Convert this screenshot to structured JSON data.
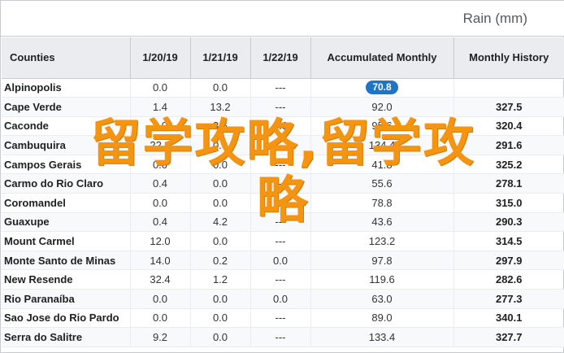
{
  "title": "Rain (mm)",
  "columns": [
    "Counties",
    "1/20/19",
    "1/21/19",
    "1/22/19",
    "Accumulated Monthly",
    "Monthly History"
  ],
  "rows": [
    {
      "name": "Alpinopolis",
      "d1": "0.0",
      "d2": "0.0",
      "d3": "---",
      "acc": "70.8",
      "hist": ""
    },
    {
      "name": "Cape Verde",
      "d1": "1.4",
      "d2": "13.2",
      "d3": "---",
      "acc": "92.0",
      "hist": "327.5"
    },
    {
      "name": "Caconde",
      "d1": "0.0",
      "d2": "3.6",
      "d3": "0.0",
      "acc": "95.6",
      "hist": "320.4"
    },
    {
      "name": "Cambuquira",
      "d1": "22.0",
      "d2": "0.0",
      "d3": "---",
      "acc": "134.4",
      "hist": "291.6"
    },
    {
      "name": "Campos Gerais",
      "d1": "0.0",
      "d2": "0.0",
      "d3": "---",
      "acc": "41.8",
      "hist": "325.2"
    },
    {
      "name": "Carmo do Rio Claro",
      "d1": "0.4",
      "d2": "0.0",
      "d3": "---",
      "acc": "55.6",
      "hist": "278.1"
    },
    {
      "name": "Coromandel",
      "d1": "0.0",
      "d2": "0.0",
      "d3": "---",
      "acc": "78.8",
      "hist": "315.0"
    },
    {
      "name": "Guaxupe",
      "d1": "0.4",
      "d2": "4.2",
      "d3": "---",
      "acc": "43.6",
      "hist": "290.3"
    },
    {
      "name": "Mount Carmel",
      "d1": "12.0",
      "d2": "0.0",
      "d3": "---",
      "acc": "123.2",
      "hist": "314.5"
    },
    {
      "name": "Monte Santo de Minas",
      "d1": "14.0",
      "d2": "0.2",
      "d3": "0.0",
      "acc": "97.8",
      "hist": "297.9"
    },
    {
      "name": "New Resende",
      "d1": "32.4",
      "d2": "1.2",
      "d3": "---",
      "acc": "119.6",
      "hist": "282.6"
    },
    {
      "name": "Rio Paranaíba",
      "d1": "0.0",
      "d2": "0.0",
      "d3": "0.0",
      "acc": "63.0",
      "hist": "277.3"
    },
    {
      "name": "Sao Jose do Rio Pardo",
      "d1": "0.0",
      "d2": "0.0",
      "d3": "---",
      "acc": "89.0",
      "hist": "340.1"
    },
    {
      "name": "Serra do Salitre",
      "d1": "9.2",
      "d2": "0.0",
      "d3": "---",
      "acc": "133.4",
      "hist": "327.7"
    }
  ],
  "watermark": {
    "line1": "留学攻略,留学攻",
    "line2": "略"
  },
  "colors": {
    "accent": "#1f74c6",
    "watermark": "#f39412",
    "header_bg": "#eaecf0"
  }
}
